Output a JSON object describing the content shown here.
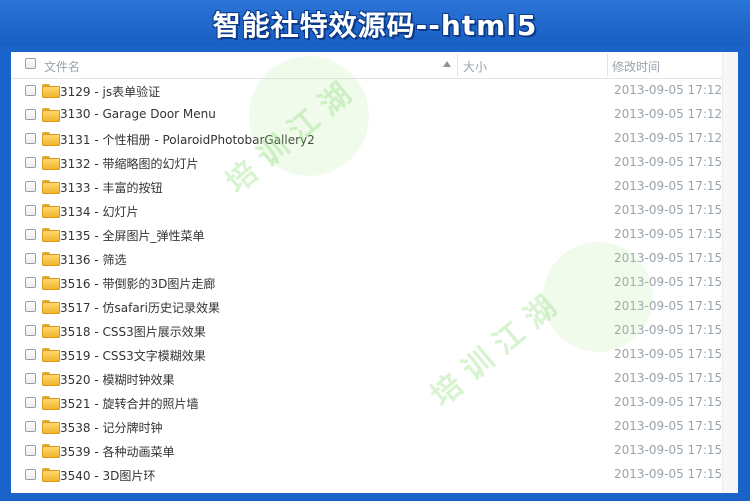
{
  "banner": {
    "title": "智能社特效源码--html5"
  },
  "header": {
    "name_col": "文件名",
    "size_col": "大小",
    "time_col": "修改时间"
  },
  "files": [
    {
      "name": "3129 - js表单验证",
      "modified": "2013-09-05 17:12"
    },
    {
      "name": "3130 - Garage Door Menu",
      "modified": "2013-09-05 17:12"
    },
    {
      "name": "3131 - 个性相册 - PolaroidPhotobarGallery2",
      "modified": "2013-09-05 17:12"
    },
    {
      "name": "3132 - 带缩略图的幻灯片",
      "modified": "2013-09-05 17:15"
    },
    {
      "name": "3133 - 丰富的按钮",
      "modified": "2013-09-05 17:15"
    },
    {
      "name": "3134 - 幻灯片",
      "modified": "2013-09-05 17:15"
    },
    {
      "name": "3135 - 全屏图片_弹性菜单",
      "modified": "2013-09-05 17:15"
    },
    {
      "name": "3136 - 筛选",
      "modified": "2013-09-05 17:15"
    },
    {
      "name": "3516 - 带倒影的3D图片走廊",
      "modified": "2013-09-05 17:15"
    },
    {
      "name": "3517 - 仿safari历史记录效果",
      "modified": "2013-09-05 17:15"
    },
    {
      "name": "3518 - CSS3图片展示效果",
      "modified": "2013-09-05 17:15"
    },
    {
      "name": "3519 - CSS3文字模糊效果",
      "modified": "2013-09-05 17:15"
    },
    {
      "name": "3520 - 模糊时钟效果",
      "modified": "2013-09-05 17:15"
    },
    {
      "name": "3521 - 旋转合并的照片墙",
      "modified": "2013-09-05 17:15"
    },
    {
      "name": "3538 - 记分牌时钟",
      "modified": "2013-09-05 17:15"
    },
    {
      "name": "3539 - 各种动画菜单",
      "modified": "2013-09-05 17:15"
    },
    {
      "name": "3540 - 3D图片环",
      "modified": "2013-09-05 17:15"
    }
  ],
  "watermark": {
    "text_top": "培 训 江 湖",
    "text_bottom": "培 训 江 湖"
  },
  "colors": {
    "background": "#1a63c9",
    "folder": "#f3b42e",
    "timestamp": "#9aa3ad"
  }
}
